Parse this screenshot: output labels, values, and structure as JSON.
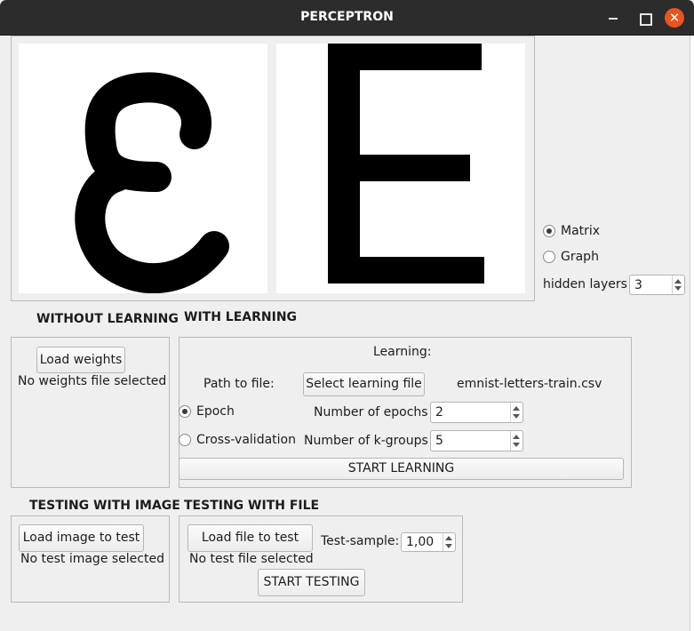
{
  "window": {
    "title": "PERCEPTRON",
    "close_glyph": "✕"
  },
  "view_mode": {
    "options": [
      "Matrix",
      "Graph"
    ],
    "selected": "Matrix"
  },
  "hidden_layers": {
    "label": "hidden layers",
    "value": "3"
  },
  "without_learning": {
    "heading": "WITHOUT LEARNING",
    "load_weights_label": "Load weights",
    "status": "No weights file selected"
  },
  "with_learning": {
    "heading": "WITH LEARNING",
    "group_title": "Learning:",
    "path_label": "Path to file:",
    "select_file_label": "Select learning file",
    "file_name": "emnist-letters-train.csv",
    "mode_options": [
      "Epoch",
      "Cross-validation"
    ],
    "mode_selected": "Epoch",
    "epochs_label": "Number of epochs",
    "epochs_value": "2",
    "kgroups_label": "Number of k-groups",
    "kgroups_value": "5",
    "start_label": "START LEARNING"
  },
  "testing_image": {
    "heading": "TESTING WITH IMAGE",
    "load_label": "Load image to test",
    "status": "No test image selected"
  },
  "testing_file": {
    "heading": "TESTING WITH FILE",
    "load_label": "Load file to test",
    "sample_label": "Test-sample:",
    "sample_value": "1,00",
    "status": "No test file selected",
    "start_label": "START TESTING"
  },
  "images": {
    "input_drawing": "handwritten-epsilon-like-letter",
    "prediction_glyph": "E"
  }
}
